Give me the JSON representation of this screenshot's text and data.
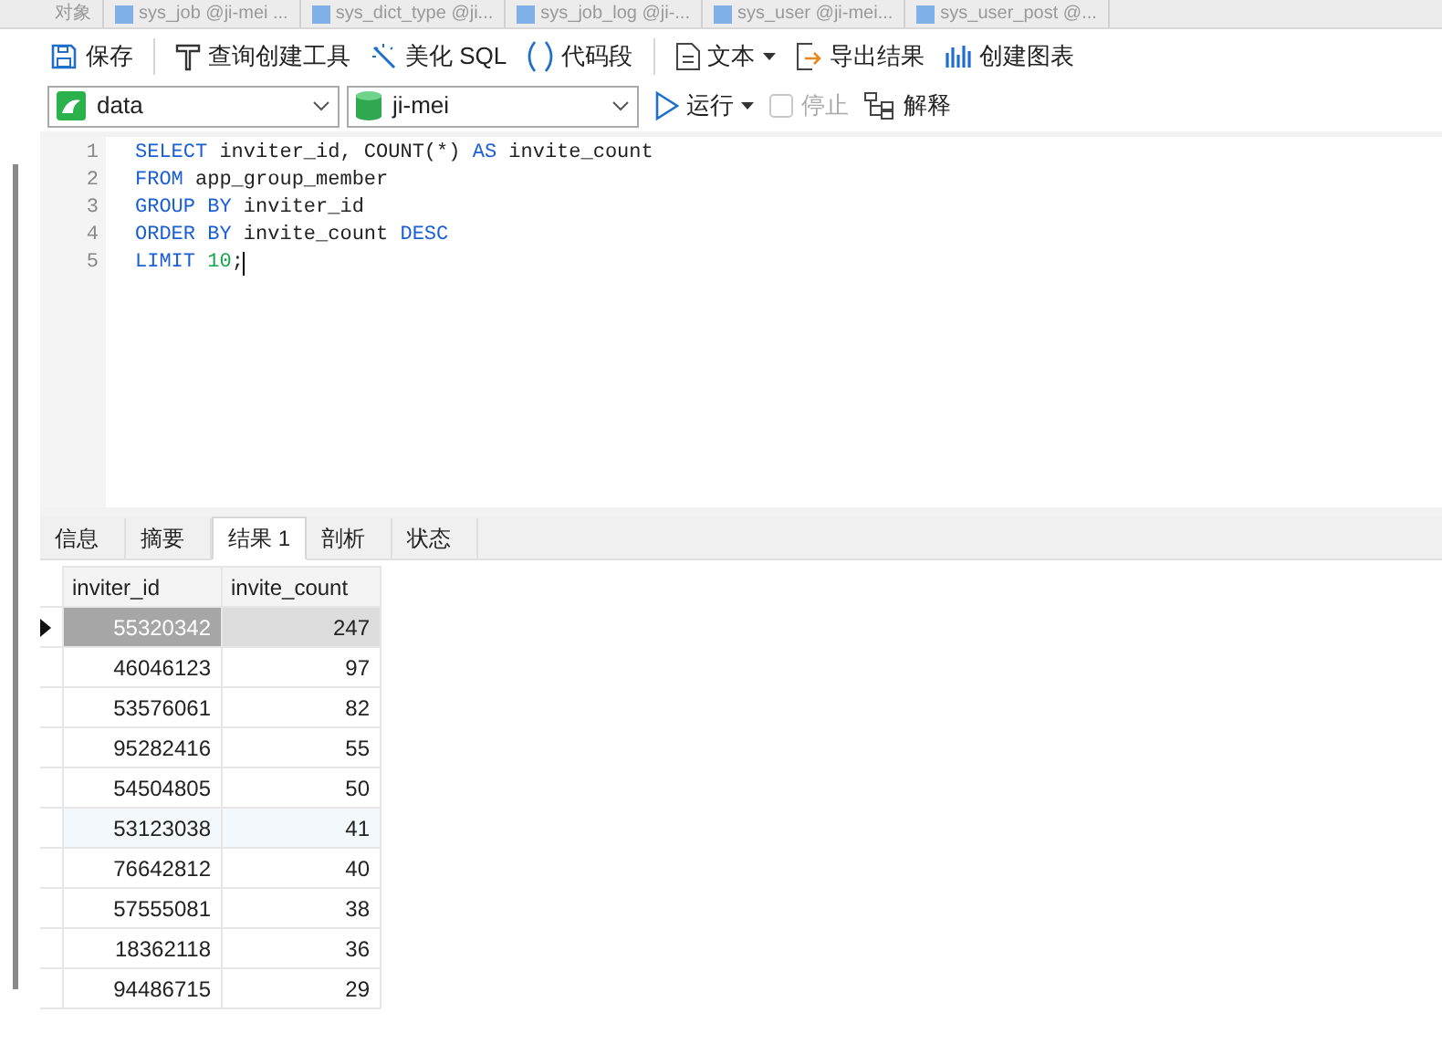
{
  "doc_tabs": [
    {
      "label": "对象",
      "selected": false
    },
    {
      "label": "sys_job @ji-mei ...",
      "selected": false
    },
    {
      "label": "sys_dict_type @ji...",
      "selected": false
    },
    {
      "label": "sys_job_log @ji-...",
      "selected": false
    },
    {
      "label": "sys_user @ji-mei...",
      "selected": false
    },
    {
      "label": "sys_user_post @...",
      "selected": false
    }
  ],
  "toolbar": [
    {
      "kind": "save",
      "label": "保存"
    },
    {
      "kind": "divider"
    },
    {
      "kind": "builder",
      "label": "查询创建工具"
    },
    {
      "kind": "beautify",
      "label": "美化 SQL"
    },
    {
      "kind": "snippet",
      "label": "代码段"
    },
    {
      "kind": "divider"
    },
    {
      "kind": "text",
      "label": "文本",
      "dropdown": true
    },
    {
      "kind": "export",
      "label": "导出结果"
    },
    {
      "kind": "chart",
      "label": "创建图表"
    }
  ],
  "connection": "data",
  "database": "ji-mei",
  "actions": [
    {
      "kind": "run",
      "label": "运行",
      "disabled": false,
      "dropdown": true
    },
    {
      "kind": "stop",
      "label": "停止",
      "disabled": true
    },
    {
      "kind": "explain",
      "label": "解释",
      "disabled": false
    }
  ],
  "editor": {
    "lines": [
      [
        {
          "kind": "keyword",
          "text": "SELECT"
        },
        {
          "kind": "ident",
          "text": " inviter_id, COUNT(*) "
        },
        {
          "kind": "keyword",
          "text": "AS"
        },
        {
          "kind": "ident",
          "text": " invite_count"
        }
      ],
      [
        {
          "kind": "keyword",
          "text": "FROM"
        },
        {
          "kind": "ident",
          "text": " app_group_member"
        }
      ],
      [
        {
          "kind": "keyword",
          "text": "GROUP BY"
        },
        {
          "kind": "ident",
          "text": " inviter_id"
        }
      ],
      [
        {
          "kind": "keyword",
          "text": "ORDER BY"
        },
        {
          "kind": "ident",
          "text": " invite_count "
        },
        {
          "kind": "keyword",
          "text": "DESC"
        }
      ],
      [
        {
          "kind": "keyword",
          "text": "LIMIT"
        },
        {
          "kind": "number",
          "text": " 10"
        },
        {
          "kind": "ident",
          "text": ";"
        }
      ]
    ],
    "line_numbers": [
      "1",
      "2",
      "3",
      "4",
      "5"
    ]
  },
  "result_tabs": [
    {
      "label": "信息",
      "selected": false
    },
    {
      "label": "摘要",
      "selected": false
    },
    {
      "label": "结果 1",
      "selected": true
    },
    {
      "label": "剖析",
      "selected": false
    },
    {
      "label": "状态",
      "selected": false
    }
  ],
  "table": {
    "columns": [
      "inviter_id",
      "invite_count"
    ],
    "rows": [
      {
        "cells": [
          "55320342",
          "247"
        ],
        "selected": true,
        "hovered": false
      },
      {
        "cells": [
          "46046123",
          "97"
        ],
        "selected": false,
        "hovered": false
      },
      {
        "cells": [
          "53576061",
          "82"
        ],
        "selected": false,
        "hovered": false
      },
      {
        "cells": [
          "95282416",
          "55"
        ],
        "selected": false,
        "hovered": false
      },
      {
        "cells": [
          "54504805",
          "50"
        ],
        "selected": false,
        "hovered": false
      },
      {
        "cells": [
          "53123038",
          "41"
        ],
        "selected": false,
        "hovered": true
      },
      {
        "cells": [
          "76642812",
          "40"
        ],
        "selected": false,
        "hovered": false
      },
      {
        "cells": [
          "57555081",
          "38"
        ],
        "selected": false,
        "hovered": false
      },
      {
        "cells": [
          "18362118",
          "36"
        ],
        "selected": false,
        "hovered": false
      },
      {
        "cells": [
          "94486715",
          "29"
        ],
        "selected": false,
        "hovered": false
      }
    ]
  }
}
